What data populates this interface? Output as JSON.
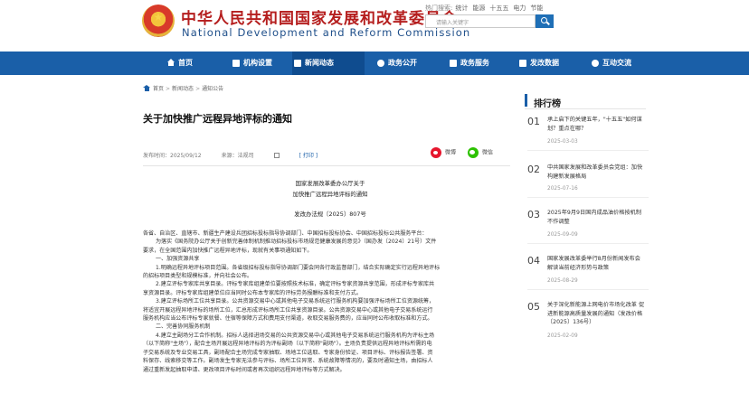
{
  "header": {
    "site_title_cn": "中华人民共和国国家发展和改革委员会",
    "site_title_en": "National Development and Reform Commission",
    "hot_label": "热门搜索:",
    "hot_terms": [
      "统计",
      "能源",
      "十五五",
      "电力",
      "节能"
    ],
    "search_placeholder": "请输入关键字"
  },
  "nav": {
    "items": [
      {
        "label": "首页",
        "icon": "house-icon"
      },
      {
        "label": "机构设置",
        "icon": "org-icon"
      },
      {
        "label": "新闻动态",
        "icon": "news-icon"
      },
      {
        "label": "政务公开",
        "icon": "open-icon"
      },
      {
        "label": "政务服务",
        "icon": "service-icon"
      },
      {
        "label": "发改数据",
        "icon": "data-icon"
      },
      {
        "label": "互动交流",
        "icon": "chat-icon"
      }
    ],
    "active_index": 2,
    "color": "#1a5fa8"
  },
  "breadcrumb": [
    "首页",
    "新闻动态",
    "通知公告"
  ],
  "article": {
    "title": "关于加快推广远程异地评标的通知",
    "publish_time": "发布时间：2025/09/12",
    "source": "来源：法规司",
    "print_label": "[ 打印 ]",
    "share": {
      "weibo": "微博",
      "wechat": "微信"
    },
    "doc_issuer_1": "国家发展改革委办公厅关于",
    "doc_issuer_2": "加快推广远程异地评标的通知",
    "doc_number": "发改办法规〔2025〕807号",
    "lines": [
      "各省、自治区、直辖市、新疆生产建设兵团招标投标指导协调部门、中国招标投标协会、中国招标投标公共服务平台：",
      "为落实《国务院办公厅关于创新完善体制机制推动招标投标市场规范健康发展的意见》（国办发〔2024〕21号）文件",
      "要求，在全国范围内加快推广远程异地评标，现就有关事项通知如下。",
      "一、加强资源共享",
      "1.明确远程异地评标项目范围。各省级招标投标指导协调部门要会同各行政监督部门，结合实际确定实行远程异地评标",
      "的招标项目类型和规模标准，并向社会公布。",
      "2.建立评标专家库共享目录。评标专家库组建单位要按照技术标准，确定评标专家资源共享范围，形成评标专家库共",
      "享资源目录。评标专家库组建单位应当同时公布本专家库的评标劳务报酬标准和支付方式。",
      "3.建立评标场所工位共享目录。公共资源交易中心或其他电子交易系统运行服务机构要加强评标场所工位资源统筹，",
      "将适宜开展远程异地评标的场所工位，汇总形成评标场所工位共享资源目录。公共资源交易中心或其他电子交易系统运行",
      "服务机构应当公布评标专家就餐、住宿等保障方式和费用支付渠道，收取交易服务费的，应当同时公布收取标准和方式。",
      "二、完善协同服务机制",
      "4.建立主副场分工合作机制。招标人选择进场交易的公共资源交易中心或其他电子交易系统运行服务机构为评标主场",
      "（以下简称\"主场\"），配合主场开展远程异地评标的为评标副场（以下简称\"副场\"）。主场负责提供远程异地评标所需的电",
      "子交易系统及专业交易工具，副场配合主场完成专家抽取、场地工位选取、专家身份验证、项目评标、评标报告签署、资",
      "料保存、线索移交等工作。副场发生专家无法参与评标、场所工位异常、系统故障等情况的，要及时通知主场，由招标人",
      "通过重新发起抽取申请、更改项目评标时间或者再次组织远程异地评标等方式解决。"
    ]
  },
  "sidebar": {
    "title": "排行榜",
    "items": [
      {
        "num": "01",
        "title": "承上启下的关键五年，\"十五五\"如何谋划？重点在哪？",
        "date": "2025-03-03"
      },
      {
        "num": "02",
        "title": "中共国家发展和改革委员会党组：加快构建新发展格局",
        "date": "2025-07-16"
      },
      {
        "num": "03",
        "title": "2025年9月9日国内成品油价格按机制不作调整",
        "date": "2025-09-09"
      },
      {
        "num": "04",
        "title": "国家发展改革委举行8月份新闻发布会 解读当前经济形势与政策",
        "date": "2025-08-29"
      },
      {
        "num": "05",
        "title": "关于深化新能源上网电价市场化改革 促进新能源高质量发展的通知（发改价格〔2025〕136号）",
        "date": "2025-02-09"
      }
    ]
  }
}
